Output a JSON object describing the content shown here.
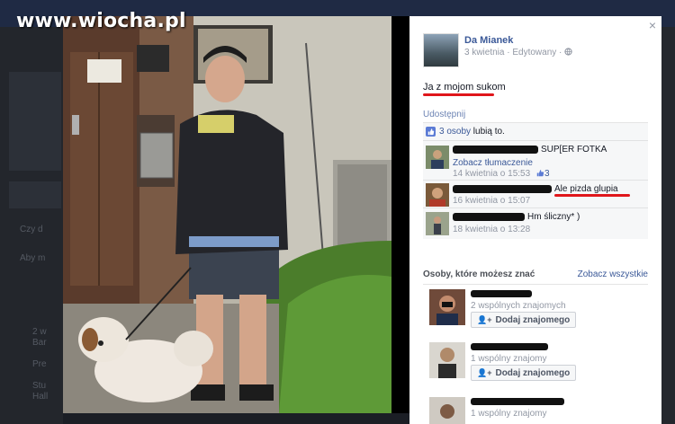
{
  "watermark": "www.wiocha.pl",
  "background": {
    "snippets": [
      "Czy d",
      "Aby m",
      "2 w",
      "Bar",
      "Pre",
      "Stu",
      "Hall"
    ]
  },
  "post": {
    "author": "Da Mianek",
    "meta": "3 kwietnia · Edytowany ·",
    "globe_icon": "globe-icon",
    "text": "Ja z mojom sukom",
    "share_label": "Udostępnij",
    "close_symbol": "×"
  },
  "likes": {
    "count_link": "3 osoby",
    "suffix": " lubią to."
  },
  "comments": [
    {
      "text": "SUP[ER FOTKA",
      "sub": "Zobacz tłumaczenie",
      "time": "14 kwietnia o 15:53",
      "likes": "3"
    },
    {
      "text": "Ale pizda glupia",
      "sub": "",
      "time": "16 kwietnia o 15:07",
      "likes": ""
    },
    {
      "text": "Hm śliczny* )",
      "sub": "",
      "time": "18 kwietnia o 13:28",
      "likes": ""
    }
  ],
  "people": {
    "title": "Osoby, które możesz znać",
    "see_all": "Zobacz wszystkie",
    "items": [
      {
        "mutual": "2 wspólnych znajomych",
        "button": "Dodaj znajomego"
      },
      {
        "mutual": "1 wspólny znajomy",
        "button": "Dodaj znajomego"
      },
      {
        "mutual": "1 wspólny znajomy",
        "button": ""
      }
    ]
  },
  "colors": {
    "link": "#3b5998",
    "accent_red": "#e0161b",
    "panel_bg": "#ffffff"
  }
}
